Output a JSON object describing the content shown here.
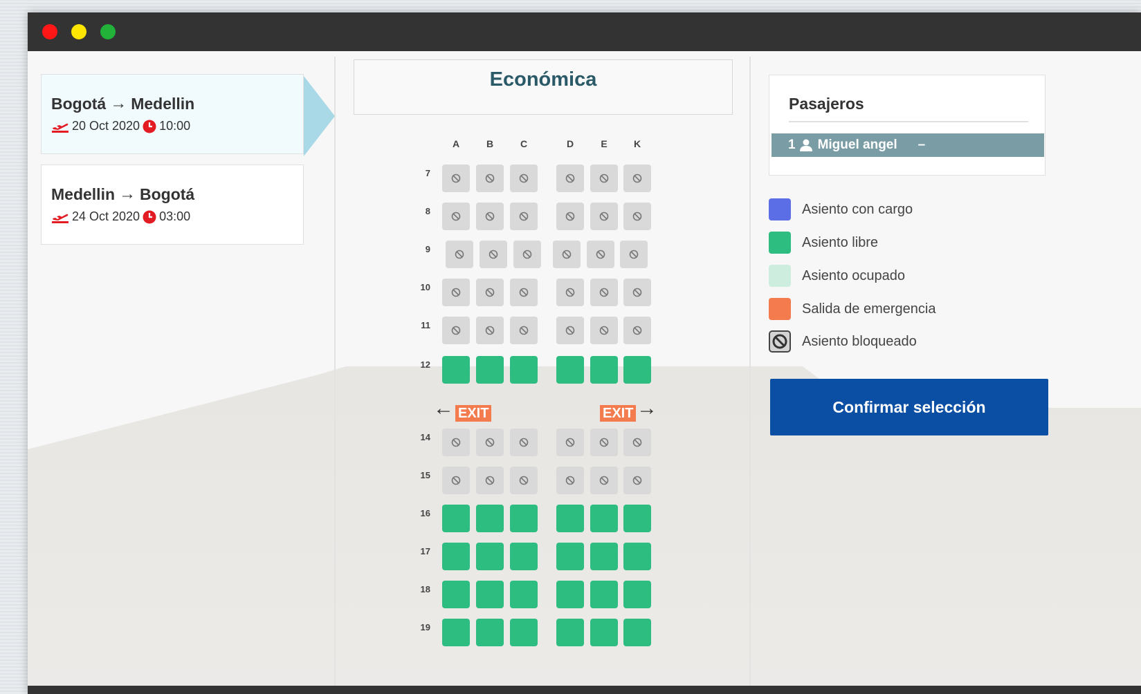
{
  "window": {
    "controls": [
      "close",
      "minimize",
      "maximize"
    ]
  },
  "flights": [
    {
      "from": "Bogotá",
      "to": "Medellin",
      "date": "20 Oct 2020",
      "time": "10:00",
      "active": true
    },
    {
      "from": "Medellin",
      "to": "Bogotá",
      "date": "24 Oct 2020",
      "time": "03:00",
      "active": false
    }
  ],
  "cabin": {
    "title": "Económica",
    "columns": [
      "A",
      "B",
      "C",
      "D",
      "E",
      "K"
    ],
    "rows": [
      {
        "number": "7",
        "status": "blocked"
      },
      {
        "number": "8",
        "status": "blocked"
      },
      {
        "number": "9",
        "status": "blocked"
      },
      {
        "number": "10",
        "status": "blocked"
      },
      {
        "number": "11",
        "status": "blocked"
      },
      {
        "number": "12",
        "status": "free"
      },
      {
        "number": "14",
        "status": "blocked"
      },
      {
        "number": "15",
        "status": "blocked"
      },
      {
        "number": "16",
        "status": "free"
      },
      {
        "number": "17",
        "status": "free"
      },
      {
        "number": "18",
        "status": "free"
      },
      {
        "number": "19",
        "status": "free"
      }
    ],
    "exit_label": "EXIT"
  },
  "passengers": {
    "title": "Pasajeros",
    "list": [
      {
        "number": "1",
        "name": "Miguel angel",
        "seat": "–"
      }
    ]
  },
  "legend": [
    {
      "label": "Asiento con cargo",
      "color": "#5b6ee6"
    },
    {
      "label": "Asiento libre",
      "color": "#2dbd80"
    },
    {
      "label": "Asiento ocupado",
      "color": "#cdeede"
    },
    {
      "label": "Salida de emergencia",
      "color": "#f47b4e"
    },
    {
      "label": "Asiento bloqueado",
      "color": "#dddddd",
      "icon": "blocked-icon"
    }
  ],
  "actions": {
    "confirm_label": "Confirmar selección"
  },
  "colors": {
    "accent": "#0a4fa3",
    "free": "#2dbd80",
    "blocked": "#d9d9d9",
    "exit": "#f47b4e"
  }
}
